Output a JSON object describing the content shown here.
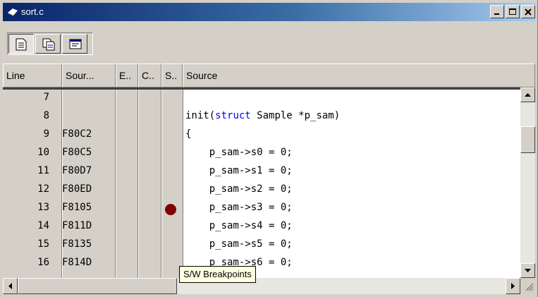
{
  "window": {
    "title": "sort.c"
  },
  "title_buttons": [
    "minimize-button",
    "maximize-button",
    "close-button"
  ],
  "toolbar": {
    "buttons": [
      "source-view-icon",
      "mixed-view-icon",
      "disassembly-view-icon"
    ]
  },
  "columns": [
    "Line",
    "Sour...",
    "E..",
    "C..",
    "S..",
    "Source"
  ],
  "rows": [
    {
      "line": "7",
      "address": "",
      "source": "",
      "breakpoint": false
    },
    {
      "line": "8",
      "address": "",
      "source": "init(struct Sample *p_sam)",
      "breakpoint": false
    },
    {
      "line": "9",
      "address": "F80C2",
      "source": "{",
      "breakpoint": false
    },
    {
      "line": "10",
      "address": "F80C5",
      "source": "    p_sam->s0 = 0;",
      "breakpoint": false
    },
    {
      "line": "11",
      "address": "F80D7",
      "source": "    p_sam->s1 = 0;",
      "breakpoint": false
    },
    {
      "line": "12",
      "address": "F80ED",
      "source": "    p_sam->s2 = 0;",
      "breakpoint": false
    },
    {
      "line": "13",
      "address": "F8105",
      "source": "    p_sam->s3 = 0;",
      "breakpoint": true
    },
    {
      "line": "14",
      "address": "F811D",
      "source": "    p_sam->s4 = 0;",
      "breakpoint": false
    },
    {
      "line": "15",
      "address": "F8135",
      "source": "    p_sam->s5 = 0;",
      "breakpoint": false
    },
    {
      "line": "16",
      "address": "F814D",
      "source": "    p_sam->s6 = 0;",
      "breakpoint": false
    }
  ],
  "tooltip": "S/W Breakpoints",
  "colors": {
    "keyword": "#0000ff",
    "breakpoint": "#800000",
    "titlebar": "#0a246a",
    "tooltip_bg": "#ffffe1"
  }
}
